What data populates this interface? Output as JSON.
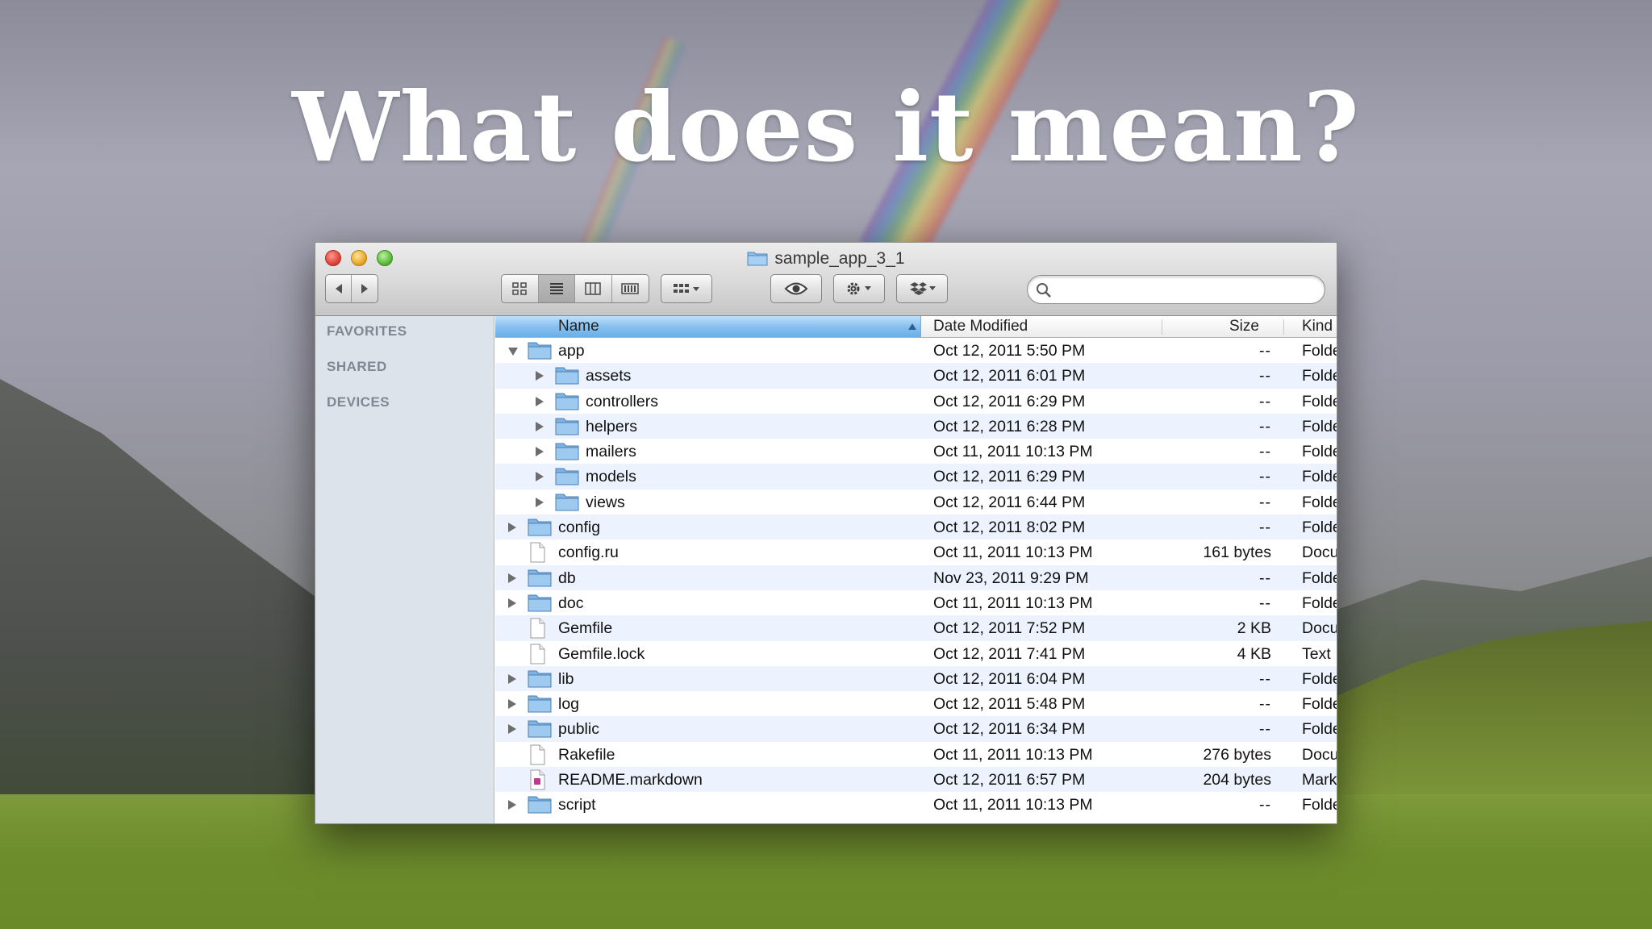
{
  "slide": {
    "title": "What does it mean?"
  },
  "window": {
    "title": "sample_app_3_1",
    "toolbar": {
      "back_icon": "chevron-left-icon",
      "forward_icon": "chevron-right-icon",
      "view_modes": [
        "icon-view",
        "list-view",
        "column-view",
        "cover-flow-view"
      ],
      "active_view": "list-view"
    },
    "search": {
      "placeholder": "",
      "value": ""
    }
  },
  "sidebar": {
    "sections": [
      "FAVORITES",
      "SHARED",
      "DEVICES"
    ]
  },
  "columns": {
    "name": "Name",
    "date": "Date Modified",
    "size": "Size",
    "kind": "Kind"
  },
  "files": [
    {
      "name": "app",
      "date": "Oct 12, 2011 5:50 PM",
      "size": "--",
      "kind": "Folder",
      "type": "folder",
      "level": 0,
      "disclosure": "open"
    },
    {
      "name": "assets",
      "date": "Oct 12, 2011 6:01 PM",
      "size": "--",
      "kind": "Folder",
      "type": "folder",
      "level": 1,
      "disclosure": "closed"
    },
    {
      "name": "controllers",
      "date": "Oct 12, 2011 6:29 PM",
      "size": "--",
      "kind": "Folder",
      "type": "folder",
      "level": 1,
      "disclosure": "closed"
    },
    {
      "name": "helpers",
      "date": "Oct 12, 2011 6:28 PM",
      "size": "--",
      "kind": "Folder",
      "type": "folder",
      "level": 1,
      "disclosure": "closed"
    },
    {
      "name": "mailers",
      "date": "Oct 11, 2011 10:13 PM",
      "size": "--",
      "kind": "Folder",
      "type": "folder",
      "level": 1,
      "disclosure": "closed"
    },
    {
      "name": "models",
      "date": "Oct 12, 2011 6:29 PM",
      "size": "--",
      "kind": "Folder",
      "type": "folder",
      "level": 1,
      "disclosure": "closed"
    },
    {
      "name": "views",
      "date": "Oct 12, 2011 6:44 PM",
      "size": "--",
      "kind": "Folder",
      "type": "folder",
      "level": 1,
      "disclosure": "closed"
    },
    {
      "name": "config",
      "date": "Oct 12, 2011 8:02 PM",
      "size": "--",
      "kind": "Folder",
      "type": "folder",
      "level": 0,
      "disclosure": "closed"
    },
    {
      "name": "config.ru",
      "date": "Oct 11, 2011 10:13 PM",
      "size": "161 bytes",
      "kind": "Document",
      "type": "file",
      "level": 0,
      "disclosure": "none"
    },
    {
      "name": "db",
      "date": "Nov 23, 2011 9:29 PM",
      "size": "--",
      "kind": "Folder",
      "type": "folder",
      "level": 0,
      "disclosure": "closed"
    },
    {
      "name": "doc",
      "date": "Oct 11, 2011 10:13 PM",
      "size": "--",
      "kind": "Folder",
      "type": "folder",
      "level": 0,
      "disclosure": "closed"
    },
    {
      "name": "Gemfile",
      "date": "Oct 12, 2011 7:52 PM",
      "size": "2 KB",
      "kind": "Document",
      "type": "file",
      "level": 0,
      "disclosure": "none"
    },
    {
      "name": "Gemfile.lock",
      "date": "Oct 12, 2011 7:41 PM",
      "size": "4 KB",
      "kind": "Text",
      "type": "file",
      "level": 0,
      "disclosure": "none"
    },
    {
      "name": "lib",
      "date": "Oct 12, 2011 6:04 PM",
      "size": "--",
      "kind": "Folder",
      "type": "folder",
      "level": 0,
      "disclosure": "closed"
    },
    {
      "name": "log",
      "date": "Oct 12, 2011 5:48 PM",
      "size": "--",
      "kind": "Folder",
      "type": "folder",
      "level": 0,
      "disclosure": "closed"
    },
    {
      "name": "public",
      "date": "Oct 12, 2011 6:34 PM",
      "size": "--",
      "kind": "Folder",
      "type": "folder",
      "level": 0,
      "disclosure": "closed"
    },
    {
      "name": "Rakefile",
      "date": "Oct 11, 2011 10:13 PM",
      "size": "276 bytes",
      "kind": "Document",
      "type": "file",
      "level": 0,
      "disclosure": "none"
    },
    {
      "name": "README.markdown",
      "date": "Oct 12, 2011 6:57 PM",
      "size": "204 bytes",
      "kind": "Markdown",
      "type": "markdown",
      "level": 0,
      "disclosure": "none"
    },
    {
      "name": "script",
      "date": "Oct 11, 2011 10:13 PM",
      "size": "--",
      "kind": "Folder",
      "type": "folder",
      "level": 0,
      "disclosure": "closed"
    }
  ],
  "colors": {
    "selection_header": "#6aaee7",
    "row_stripe": "#edf3fe",
    "folder_blue": "#7fb3e3"
  }
}
